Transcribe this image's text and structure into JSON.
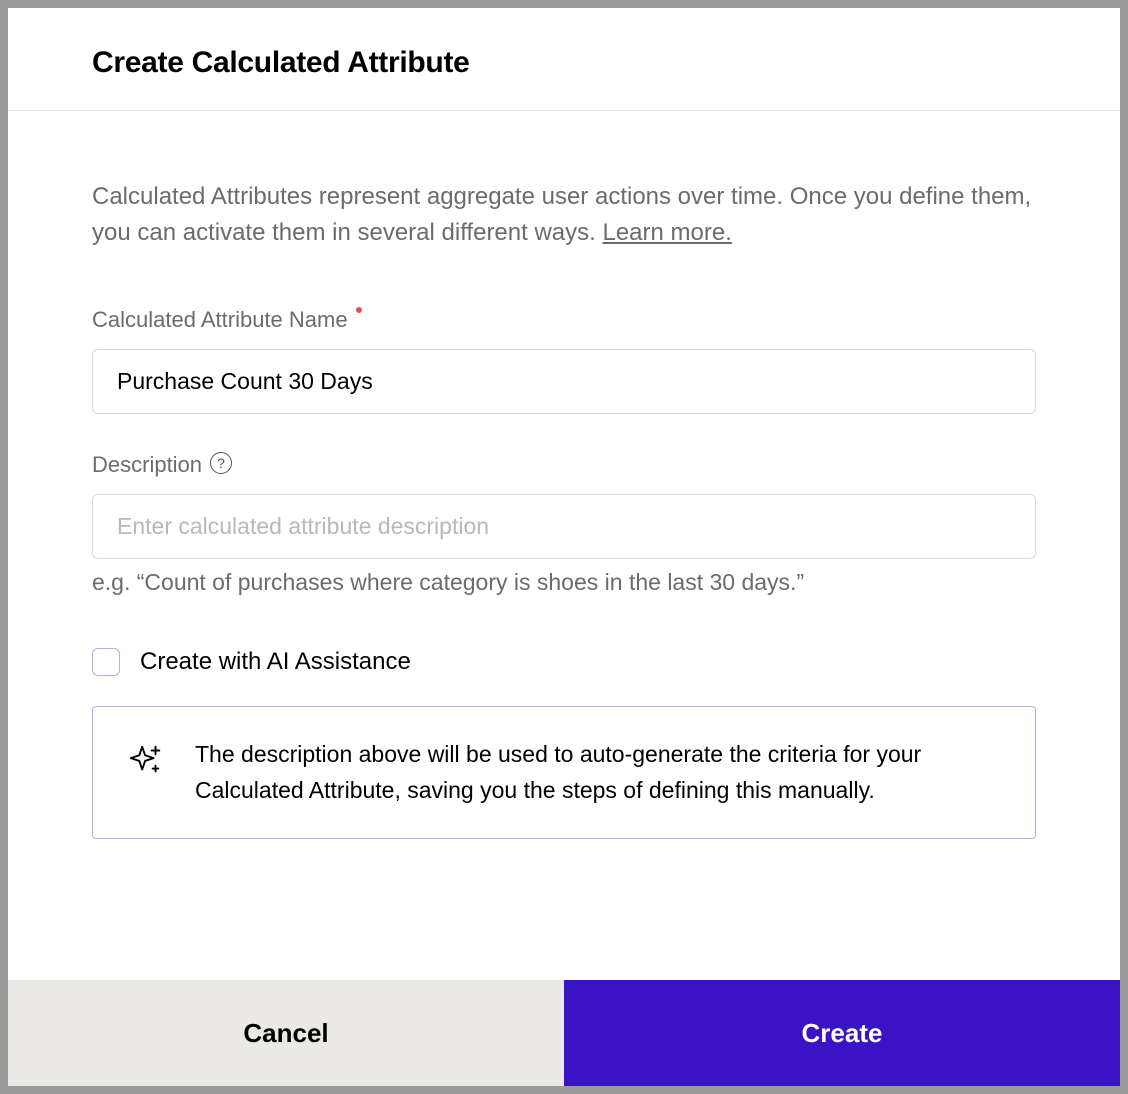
{
  "modal": {
    "title": "Create Calculated Attribute",
    "intro": "Calculated Attributes represent aggregate user actions over time. Once you define them, you can activate them in several different ways. ",
    "learnMore": "Learn more.",
    "nameField": {
      "label": "Calculated Attribute Name",
      "value": "Purchase Count 30 Days"
    },
    "descriptionField": {
      "label": "Description",
      "placeholder": "Enter calculated attribute description",
      "hint": "e.g. “Count of purchases where category is shoes in the last 30 days.”"
    },
    "aiCheckbox": {
      "label": "Create with AI Assistance"
    },
    "infoBox": {
      "text": "The description above will be used to auto-generate the criteria for your Calculated Attribute, saving you the steps of defining this manually."
    },
    "footer": {
      "cancel": "Cancel",
      "create": "Create"
    }
  }
}
